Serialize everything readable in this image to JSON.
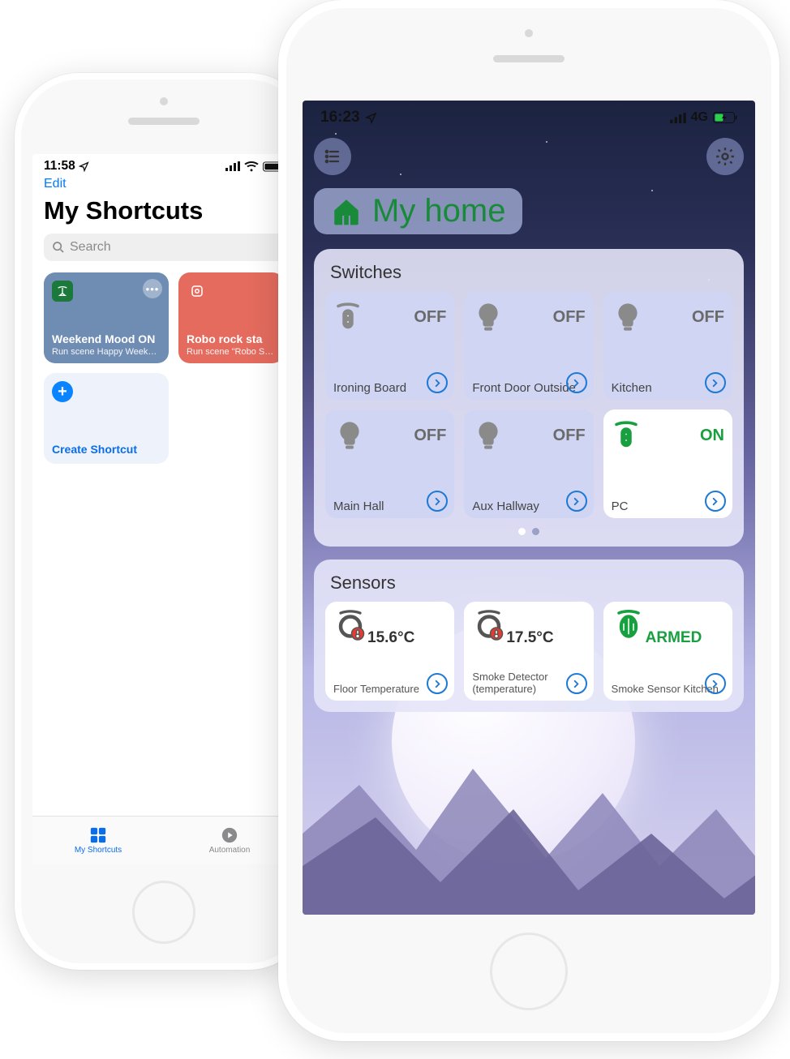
{
  "back_phone": {
    "status_time": "11:58",
    "nav_edit": "Edit",
    "page_title": "My Shortcuts",
    "search_placeholder": "Search",
    "cards": [
      {
        "title": "Weekend Mood ON",
        "subtitle": "Run scene Happy Weekend"
      },
      {
        "title": "Robo rock sta",
        "subtitle": "Run scene \"Robo Start cleaning\""
      }
    ],
    "create_label": "Create Shortcut",
    "tabs": {
      "shortcuts": "My Shortcuts",
      "automation": "Automation"
    }
  },
  "front_phone": {
    "status_time": "16:23",
    "network_label": "4G",
    "home_title": "My home",
    "switches_panel_title": "Switches",
    "switches": [
      {
        "label": "Ironing Board",
        "state": "OFF",
        "icon": "plug",
        "on": false
      },
      {
        "label": "Front Door Outside",
        "state": "OFF",
        "icon": "bulb",
        "on": false
      },
      {
        "label": "Kitchen",
        "state": "OFF",
        "icon": "bulb",
        "on": false
      },
      {
        "label": "Main Hall",
        "state": "OFF",
        "icon": "bulb",
        "on": false
      },
      {
        "label": "Aux Hallway",
        "state": "OFF",
        "icon": "bulb",
        "on": false
      },
      {
        "label": "PC",
        "state": "ON",
        "icon": "plug",
        "on": true
      }
    ],
    "sensors_panel_title": "Sensors",
    "sensors": [
      {
        "label": "Floor Temperature",
        "value": "15.6°C",
        "icon": "temp",
        "armed": false
      },
      {
        "label": "Smoke Detector (temperature)",
        "value": "17.5°C",
        "icon": "temp",
        "armed": false
      },
      {
        "label": "Smoke Sensor Kitchen",
        "value": "ARMED",
        "icon": "siren",
        "armed": true
      }
    ]
  }
}
